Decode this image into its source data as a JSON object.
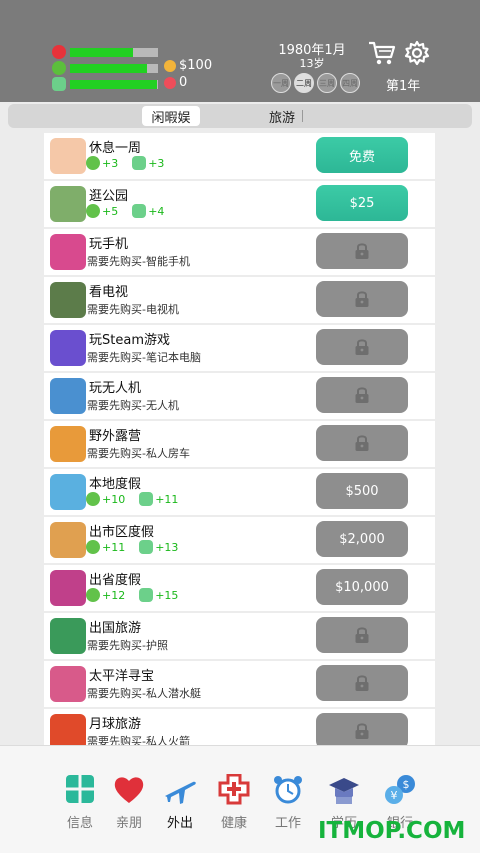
{
  "status": {
    "health_level": 0.72,
    "happiness_level": 0.88,
    "smarts_level": 0.99,
    "money": "$100",
    "hearts": "0"
  },
  "calendar": {
    "date": "1980年1月",
    "age": "13岁",
    "weeks": [
      "一周",
      "二周",
      "三周",
      "四周"
    ],
    "active_week_index": 1,
    "year": "第1年"
  },
  "tabs": [
    "闲暇娱",
    "旅游"
  ],
  "items": [
    {
      "name": "休息一周",
      "stats": [
        "+3",
        "+3"
      ],
      "button": "免费",
      "style": "teal"
    },
    {
      "name": "逛公园",
      "stats": [
        "+5",
        "+4"
      ],
      "button": "$25",
      "style": "teal"
    },
    {
      "name": "玩手机",
      "sub": "需要先购买-智能手机",
      "locked": true
    },
    {
      "name": "看电视",
      "sub": "需要先购买-电视机",
      "locked": true
    },
    {
      "name": "玩Steam游戏",
      "sub": "需要先购买-笔记本电脑",
      "locked": true
    },
    {
      "name": "玩无人机",
      "sub": "需要先购买-无人机",
      "locked": true
    },
    {
      "name": "野外露营",
      "sub": "需要先购买-私人房车",
      "locked": true
    },
    {
      "name": "本地度假",
      "stats": [
        "+10",
        "+11"
      ],
      "button": "$500",
      "style": "gray"
    },
    {
      "name": "出市区度假",
      "stats": [
        "+11",
        "+13"
      ],
      "button": "$2,000",
      "style": "gray"
    },
    {
      "name": "出省度假",
      "stats": [
        "+12",
        "+15"
      ],
      "button": "$10,000",
      "style": "gray"
    },
    {
      "name": "出国旅游",
      "sub": "需要先购买-护照",
      "locked": true
    },
    {
      "name": "太平洋寻宝",
      "sub": "需要先购买-私人潜水艇",
      "locked": true
    },
    {
      "name": "月球旅游",
      "sub": "需要先购买-私人火箭",
      "locked": true
    }
  ],
  "thumb_colors": [
    "#f5c8a8",
    "#7fae6a",
    "#d84a8e",
    "#5c7c4a",
    "#6a4fcf",
    "#4a90d0",
    "#e89a3a",
    "#5ab0e0",
    "#e0a050",
    "#c0408a",
    "#3a9a5a",
    "#d85a8a",
    "#e04a2a"
  ],
  "nav": [
    {
      "label": "信息",
      "icon": "info-grid-icon",
      "color": "#2bb89a"
    },
    {
      "label": "亲朋",
      "icon": "heart-icon",
      "color": "#e0303a"
    },
    {
      "label": "外出",
      "icon": "airplane-icon",
      "color": "#3a8ad8",
      "active": true
    },
    {
      "label": "健康",
      "icon": "medical-cross-icon",
      "color": "#d83a3a"
    },
    {
      "label": "工作",
      "icon": "alarm-clock-icon",
      "color": "#3a8ad8"
    },
    {
      "label": "学历",
      "icon": "graduation-cap-icon",
      "color": "#5a6ab0"
    },
    {
      "label": "银行",
      "icon": "currency-exchange-icon",
      "color": "#3a8ad8"
    }
  ],
  "watermark": "ITMOP.COM"
}
